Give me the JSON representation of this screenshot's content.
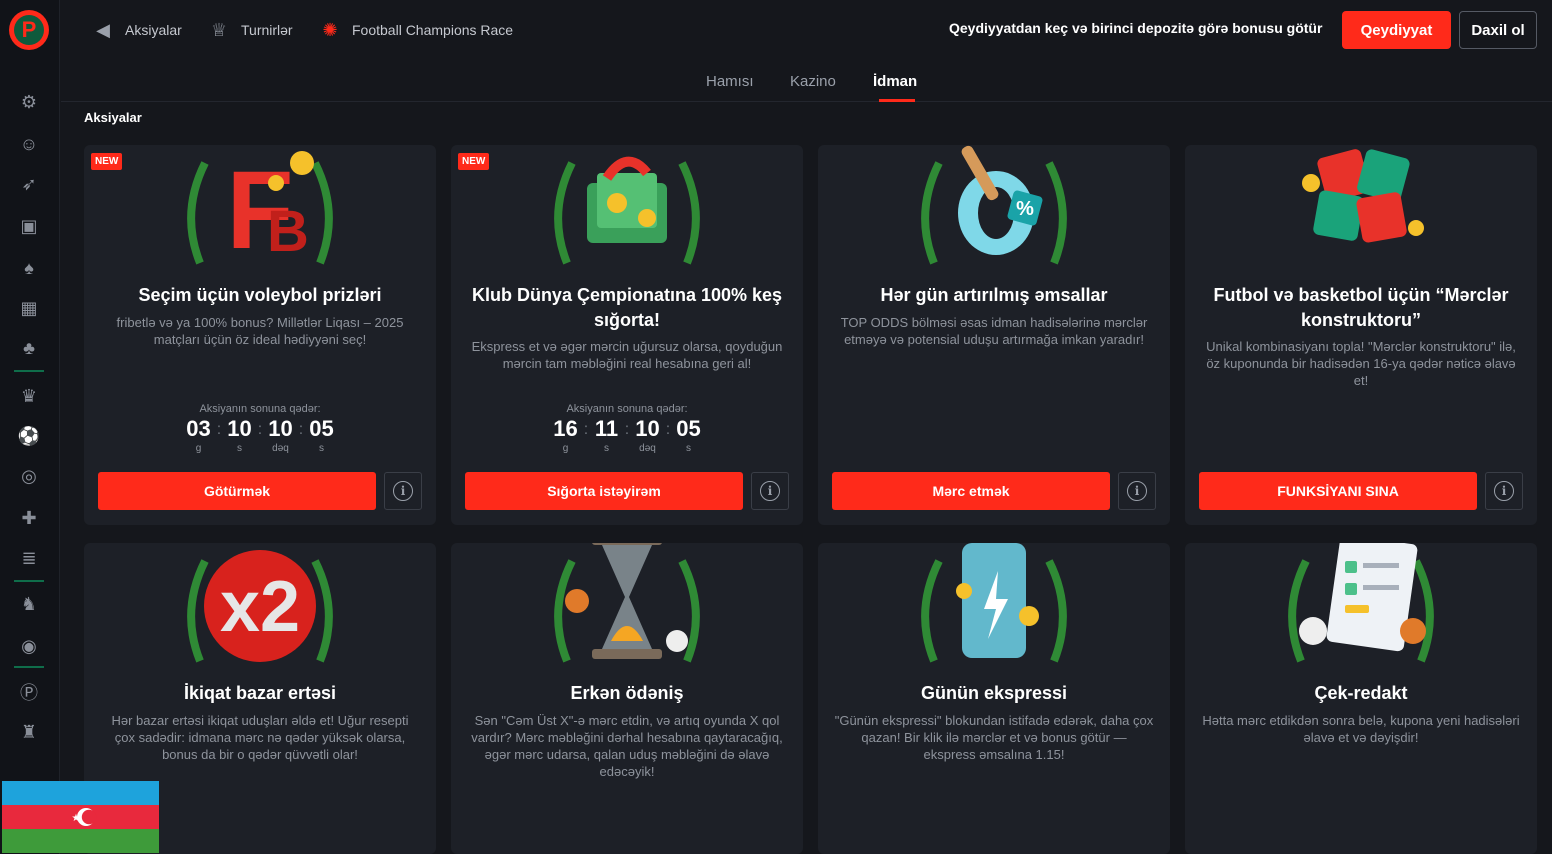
{
  "nav": {
    "promotions": "Aksiyalar",
    "tournaments": "Turnirlər",
    "race": "Football Champions Race"
  },
  "header": {
    "promo_text": "Qeydiyyatdan keç və birinci depozitə görə bonusu götür",
    "register": "Qeydiyyat",
    "login": "Daxil ol"
  },
  "tabs": [
    "Hamısı",
    "Kazino",
    "İdman"
  ],
  "active_tab": "İdman",
  "section_title": "Aksiyalar",
  "countdown_label": "Aksiyanın sonuna qədər:",
  "countdown_units": [
    "g",
    "s",
    "dəq",
    "s"
  ],
  "cards": [
    {
      "badge": "NEW",
      "title": "Seçim üçün voleybol prizləri",
      "desc": "fribetlə və ya 100% bonus? Millətlər Liqası – 2025 matçları üçün öz ideal hədiyyəni seç!",
      "countdown": [
        "03",
        "10",
        "10",
        "05"
      ],
      "button": "Götürmək"
    },
    {
      "badge": "NEW",
      "title": "Klub Dünya Çempionatına 100% keş sığorta!",
      "desc": "Ekspress et və əgər mərcin uğursuz olarsa, qoyduğun mərcin tam məbləğini real hesabına geri al!",
      "countdown": [
        "16",
        "11",
        "10",
        "05"
      ],
      "button": "Sığorta istəyirəm"
    },
    {
      "title": "Hər gün artırılmış əmsallar",
      "desc": "TOP ODDS bölməsi əsas idman hadisələrinə mərclər etməyə və potensial uduşu artırmağa imkan yaradır!",
      "button": "Mərc etmək"
    },
    {
      "title": "Futbol və basketbol üçün “Mərclər konstruktoru”",
      "desc": "Unikal kombinasiyanı topla! \"Mərclər konstruktoru\" ilə, öz kuponunda bir hadisədən 16-ya qədər nəticə əlavə et!",
      "button": "FUNKSİYANI SINA"
    },
    {
      "title": "İkiqat bazar ertəsi",
      "desc": "Hər bazar ertəsi ikiqat uduşları əldə et! Uğur resepti çox sadədir: idmana mərc nə qədər yüksək olarsa, bonus da bir o qədər qüvvətli olar!"
    },
    {
      "title": "Erkən ödəniş",
      "desc": "Sən \"Cəm Üst X\"-ə mərc etdin, və artıq oyunda X qol vardır? Mərc məbləğini dərhal hesabına qaytaracağıq, əgər mərc udarsa, qalan uduş məbləğini də əlavə edəcəyik!"
    },
    {
      "title": "Günün ekspressi",
      "desc": "\"Günün ekspressi\" blokundan istifadə edərək, daha çox qazan! Bir klik ilə mərclər et və bonus götür — ekspress əmsalına 1.15!"
    },
    {
      "title": "Çek-redakt",
      "desc": "Hətta mərc etdikdən sonra belə, kupona yeni hadisələri əlavə et və dəyişdir!"
    }
  ],
  "colors": {
    "accent": "#ff2a1a",
    "bg": "#15171c",
    "card": "#1d2027"
  }
}
